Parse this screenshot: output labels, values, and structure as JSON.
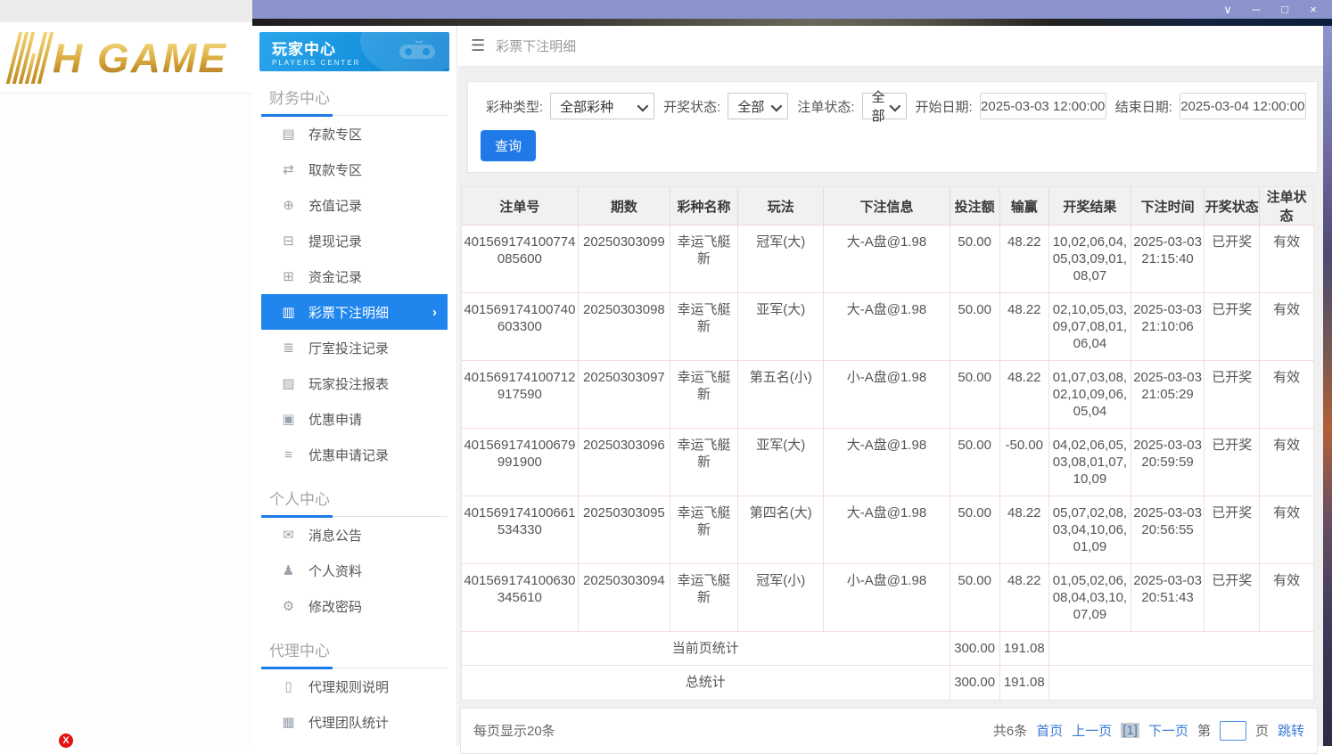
{
  "window": {
    "controls": [
      {
        "name": "chevron-down",
        "glyph": "∨"
      },
      {
        "name": "minimize",
        "glyph": "─"
      },
      {
        "name": "maximize",
        "glyph": "□"
      },
      {
        "name": "close",
        "glyph": "×"
      }
    ]
  },
  "logo": {
    "text": "H GAME"
  },
  "error_badge": {
    "glyph": "X"
  },
  "sidebar": {
    "header": {
      "title": "玩家中心",
      "subtitle": "PLAYERS CENTER",
      "icon": "gamepad-icon"
    },
    "sections": [
      {
        "heading": "财务中心",
        "items": [
          {
            "label": "存款专区",
            "icon": "deposit-card-icon",
            "glyph": "▤",
            "active": false
          },
          {
            "label": "取款专区",
            "icon": "withdraw-icon",
            "glyph": "⇄",
            "active": false
          },
          {
            "label": "充值记录",
            "icon": "recharge-record-icon",
            "glyph": "⊕",
            "active": false
          },
          {
            "label": "提现记录",
            "icon": "withdrawal-record-icon",
            "glyph": "⊟",
            "active": false
          },
          {
            "label": "资金记录",
            "icon": "funds-record-icon",
            "glyph": "⊞",
            "active": false
          },
          {
            "label": "彩票下注明细",
            "icon": "lottery-bet-detail-icon",
            "glyph": "▥",
            "active": true,
            "chevron": "›"
          },
          {
            "label": "厅室投注记录",
            "icon": "hall-bet-record-icon",
            "glyph": "≣",
            "active": false
          },
          {
            "label": "玩家投注报表",
            "icon": "player-bet-report-icon",
            "glyph": "▨",
            "active": false
          },
          {
            "label": "优惠申请",
            "icon": "promo-apply-icon",
            "glyph": "▣",
            "active": false
          },
          {
            "label": "优惠申请记录",
            "icon": "promo-apply-record-icon",
            "glyph": "≡",
            "active": false
          }
        ]
      },
      {
        "heading": "个人中心",
        "items": [
          {
            "label": "消息公告",
            "icon": "announcement-icon",
            "glyph": "✉",
            "active": false
          },
          {
            "label": "个人资料",
            "icon": "profile-icon",
            "glyph": "♟",
            "active": false
          },
          {
            "label": "修改密码",
            "icon": "change-password-icon",
            "glyph": "⚙",
            "active": false
          }
        ]
      },
      {
        "heading": "代理中心",
        "items": [
          {
            "label": "代理规则说明",
            "icon": "agent-rules-icon",
            "glyph": "▯",
            "active": false
          },
          {
            "label": "代理团队统计",
            "icon": "agent-team-stats-icon",
            "glyph": "▦",
            "active": false
          }
        ]
      }
    ]
  },
  "topbar": {
    "menu_icon": "hamburger-icon",
    "title": "彩票下注明细"
  },
  "filters": {
    "lottery_type": {
      "label": "彩种类型:",
      "value": "全部彩种"
    },
    "draw_status": {
      "label": "开奖状态:",
      "value": "全部"
    },
    "order_status": {
      "label": "注单状态:",
      "value": "全部"
    },
    "start_date": {
      "label": "开始日期:",
      "value": "2025-03-03 12:00:00"
    },
    "end_date": {
      "label": "结束日期:",
      "value": "2025-03-04 12:00:00"
    },
    "search_label": "查询"
  },
  "table": {
    "headers": [
      "注单号",
      "期数",
      "彩种名称",
      "玩法",
      "下注信息",
      "投注额",
      "输赢",
      "开奖结果",
      "下注时间",
      "开奖状态",
      "注单状态"
    ],
    "rows": [
      [
        "401569174100774085600",
        "20250303099",
        "幸运飞艇新",
        "冠军(大)",
        "大-A盘@1.98",
        "50.00",
        "48.22",
        "10,02,06,04,05,03,09,01,08,07",
        "2025-03-03 21:15:40",
        "已开奖",
        "有效"
      ],
      [
        "401569174100740603300",
        "20250303098",
        "幸运飞艇新",
        "亚军(大)",
        "大-A盘@1.98",
        "50.00",
        "48.22",
        "02,10,05,03,09,07,08,01,06,04",
        "2025-03-03 21:10:06",
        "已开奖",
        "有效"
      ],
      [
        "401569174100712917590",
        "20250303097",
        "幸运飞艇新",
        "第五名(小)",
        "小-A盘@1.98",
        "50.00",
        "48.22",
        "01,07,03,08,02,10,09,06,05,04",
        "2025-03-03 21:05:29",
        "已开奖",
        "有效"
      ],
      [
        "401569174100679991900",
        "20250303096",
        "幸运飞艇新",
        "亚军(大)",
        "大-A盘@1.98",
        "50.00",
        "-50.00",
        "04,02,06,05,03,08,01,07,10,09",
        "2025-03-03 20:59:59",
        "已开奖",
        "有效"
      ],
      [
        "401569174100661534330",
        "20250303095",
        "幸运飞艇新",
        "第四名(大)",
        "大-A盘@1.98",
        "50.00",
        "48.22",
        "05,07,02,08,03,04,10,06,01,09",
        "2025-03-03 20:56:55",
        "已开奖",
        "有效"
      ],
      [
        "401569174100630345610",
        "20250303094",
        "幸运飞艇新",
        "冠军(小)",
        "小-A盘@1.98",
        "50.00",
        "48.22",
        "01,05,02,06,08,04,03,10,07,09",
        "2025-03-03 20:51:43",
        "已开奖",
        "有效"
      ]
    ],
    "summary_rows": [
      {
        "label": "当前页统计",
        "bet_total": "300.00",
        "winloss_total": "191.08"
      },
      {
        "label": "总统计",
        "bet_total": "300.00",
        "winloss_total": "191.08"
      }
    ]
  },
  "pagination": {
    "page_size_text": "每页显示20条",
    "total_text": "共6条",
    "first": "首页",
    "prev": "上一页",
    "current": "[1]",
    "next": "下一页",
    "jump_prefix": "第",
    "jump_suffix": "页",
    "jump_action": "跳转",
    "jump_value": ""
  },
  "colors": {
    "accent_blue": "#2086ee",
    "button_blue": "#2079e8",
    "link_blue": "#3a7bd5",
    "titlebar": "#8a93cc",
    "sidebar_header_gradient": [
      "#2ba6ec",
      "#0d82d2"
    ],
    "table_border_pink": "#f3dcdc",
    "logo_gold": "#d4a017",
    "error_red": "#e31212"
  }
}
